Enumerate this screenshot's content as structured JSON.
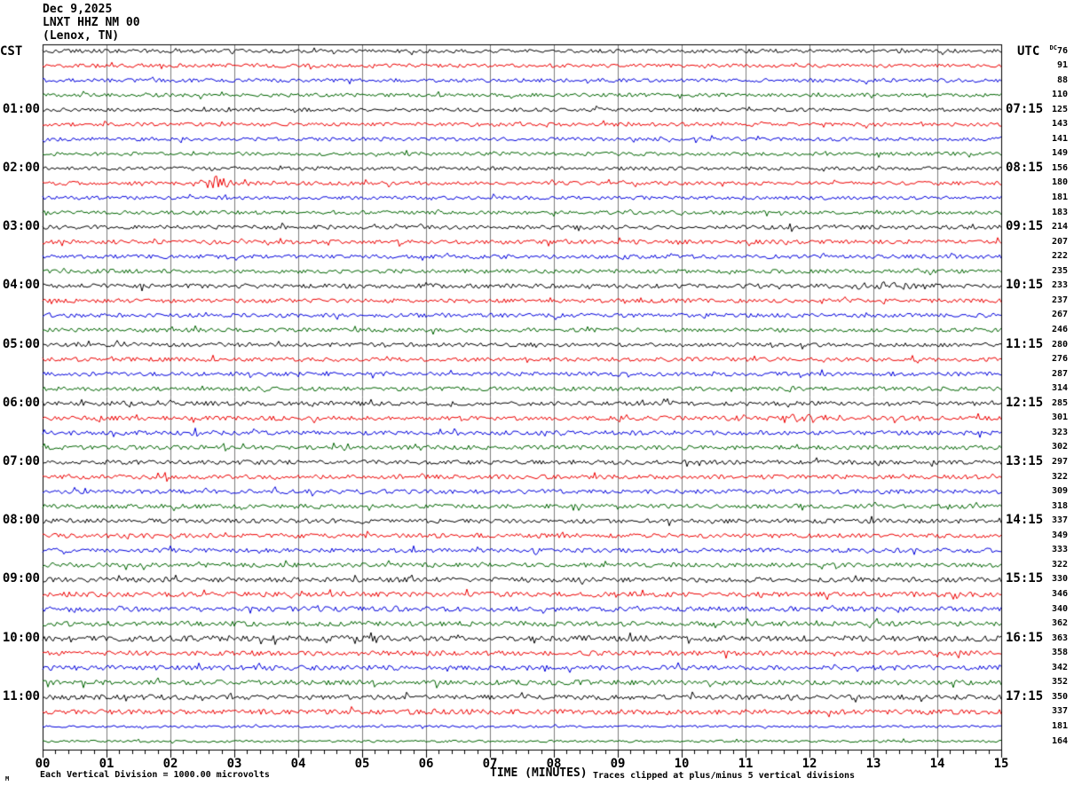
{
  "header": {
    "date": "Dec 9,2025",
    "station": "LNXT HHZ NM 00",
    "location": "(Lenox, TN)"
  },
  "axes": {
    "left_timezone": "CST",
    "right_timezone": "UTC",
    "dc_prefix": "DC",
    "left_hour_labels": [
      "01:00",
      "02:00",
      "03:00",
      "04:00",
      "05:00",
      "06:00",
      "07:00",
      "08:00",
      "09:00",
      "10:00",
      "11:00"
    ],
    "right_hour_labels": [
      "07:15",
      "08:15",
      "09:15",
      "10:15",
      "11:15",
      "12:15",
      "13:15",
      "14:15",
      "15:15",
      "16:15",
      "17:15"
    ]
  },
  "x_axis": {
    "title": "TIME (MINUTES)",
    "ticks": [
      "00",
      "01",
      "02",
      "03",
      "04",
      "05",
      "06",
      "07",
      "08",
      "09",
      "10",
      "11",
      "12",
      "13",
      "14",
      "15"
    ]
  },
  "footer": {
    "left_mark": "M",
    "scale_note": "Each Vertical Division = 1000.00 microvolts",
    "clip_note": "Traces clipped at plus/minus 5 vertical divisions"
  },
  "colors": {
    "trace_cycle": [
      "#000000",
      "#ee0000",
      "#0000dd",
      "#006400"
    ],
    "grid": "#7d7d7d",
    "border": "#000000",
    "background": "#ffffff"
  },
  "chart_data": {
    "type": "line",
    "subtype": "helicorder-seismogram",
    "title": "LNXT HHZ NM 00 (Lenox, TN) Dec 9,2025",
    "xlabel": "TIME (MINUTES)",
    "x_range_minutes": [
      0,
      15
    ],
    "minutes_per_line": 15,
    "rows": 48,
    "traces_per_hour": 4,
    "clip_divisions": 5,
    "microvolts_per_division": "1000.00",
    "row_color_cycle": [
      "black",
      "red",
      "blue",
      "green"
    ],
    "row_values": [
      76,
      91,
      88,
      110,
      125,
      143,
      141,
      149,
      156,
      180,
      181,
      183,
      214,
      207,
      222,
      235,
      233,
      237,
      267,
      246,
      280,
      276,
      287,
      314,
      285,
      301,
      323,
      302,
      297,
      322,
      309,
      318,
      337,
      349,
      333,
      322,
      330,
      346,
      340,
      362,
      363,
      358,
      342,
      352,
      350,
      337,
      181,
      164
    ],
    "amp_profile": [
      {
        "rows": [
          0,
          11
        ],
        "amp": 1.3
      },
      {
        "rows": [
          12,
          23
        ],
        "amp": 1.45
      },
      {
        "rows": [
          24,
          35
        ],
        "amp": 1.55
      },
      {
        "rows": [
          36,
          45
        ],
        "amp": 1.75
      },
      {
        "rows": [
          46,
          47
        ],
        "amp": 0.85
      }
    ],
    "amp_overrides": {
      "16": 1.6,
      "40": 2.0
    },
    "events": [
      {
        "row": 9,
        "t": 2.7,
        "w": 0.18,
        "a": 9
      },
      {
        "row": 9,
        "t": 3.15,
        "w": 0.25,
        "a": 2.5
      },
      {
        "row": 16,
        "t": 13.0,
        "w": 0.4,
        "a": 3.2
      },
      {
        "row": 16,
        "t": 13.2,
        "w": 0.05,
        "a": 6
      },
      {
        "row": 25,
        "t": 10.9,
        "w": 0.15,
        "a": 3
      },
      {
        "row": 25,
        "t": 11.9,
        "w": 0.3,
        "a": 4.5
      },
      {
        "row": 26,
        "t": 2.4,
        "w": 0.05,
        "a": 7
      },
      {
        "row": 26,
        "t": 7.8,
        "w": 0.05,
        "a": 5
      },
      {
        "row": 29,
        "t": 1.9,
        "w": 0.05,
        "a": 6
      },
      {
        "row": 36,
        "t": 10.35,
        "w": 0.06,
        "a": 3
      },
      {
        "row": 44,
        "t": 2.05,
        "w": 0.06,
        "a": 4
      }
    ]
  }
}
